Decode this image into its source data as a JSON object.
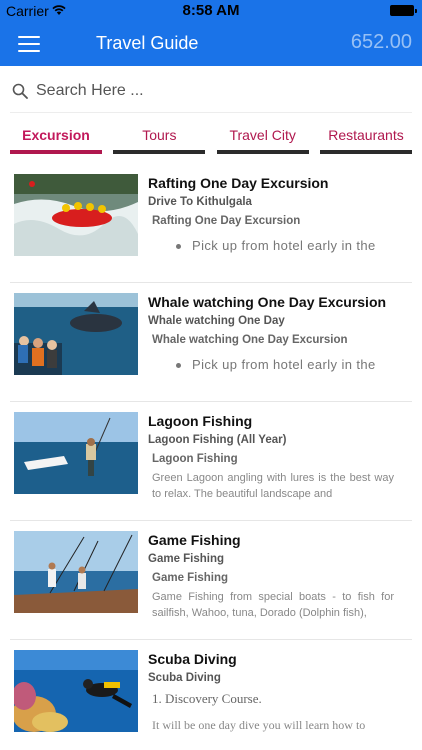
{
  "status_bar": {
    "carrier": "Carrier",
    "time": "8:58 AM"
  },
  "header": {
    "title": "Travel Guide",
    "balance": "652.00",
    "accent": "#1a73e8"
  },
  "search": {
    "placeholder": "Search Here ..."
  },
  "tabs": [
    {
      "label": "Excursion",
      "active": true
    },
    {
      "label": "Tours",
      "active": false
    },
    {
      "label": "Travel City",
      "active": false
    },
    {
      "label": "Restaurants",
      "active": false
    }
  ],
  "items": [
    {
      "title": "Rafting One Day Excursion",
      "subtitle": "Drive To Kithulgala",
      "subtitle2": "Rafting One Day Excursion",
      "bullet": "Pick up from hotel early in the"
    },
    {
      "title": "Whale watching One Day Excursion",
      "subtitle": "Whale watching One Day",
      "subtitle2": "Whale watching One Day Excursion",
      "bullet": "Pick up from hotel early in the"
    },
    {
      "title": "Lagoon Fishing",
      "subtitle": "Lagoon Fishing (All Year)",
      "subtitle2": "Lagoon Fishing",
      "description": "Green Lagoon angling with lures is the best way to relax. The beautiful landscape and"
    },
    {
      "title": "Game Fishing",
      "subtitle": "Game Fishing",
      "subtitle2": "Game Fishing",
      "description": "Game Fishing from special boats - to fish for sailfish, Wahoo, tuna, Dorado (Dolphin fish),"
    },
    {
      "title": "Scuba Diving",
      "subtitle": "Scuba Diving",
      "line1": "1. Discovery Course.",
      "line2": "It will be one day dive you will learn how to"
    }
  ]
}
